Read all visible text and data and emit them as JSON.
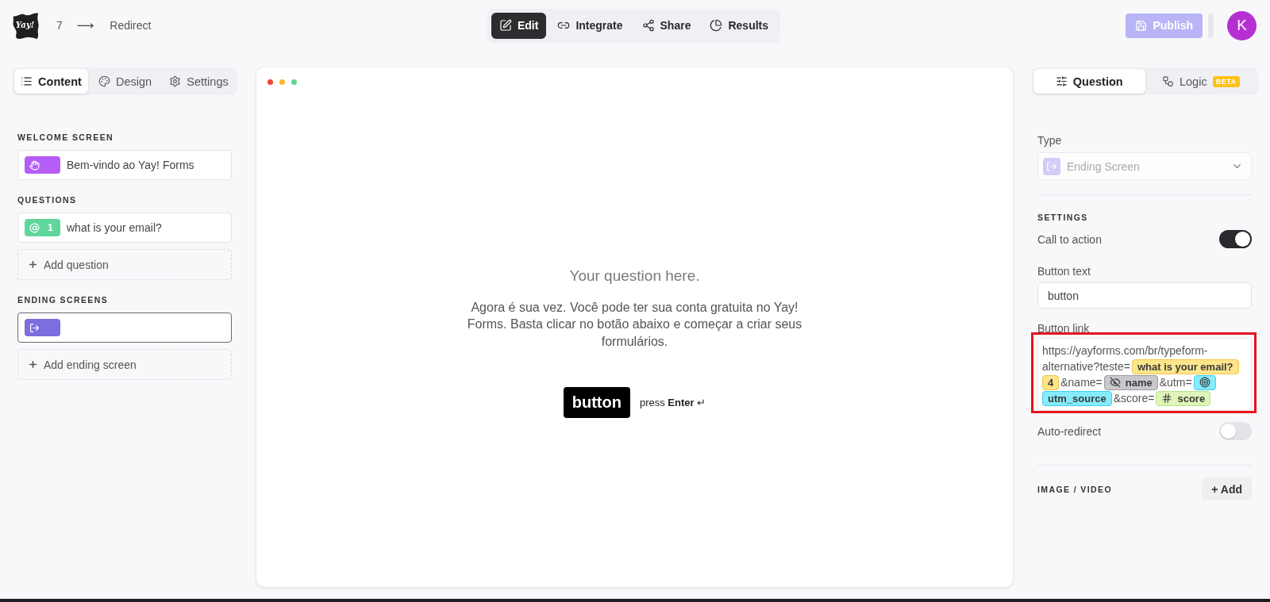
{
  "header": {
    "logo": "Yay!",
    "breadcrumb": {
      "count": "7",
      "arrow": "⟶",
      "title": "Redirect"
    },
    "nav": [
      {
        "label": "Edit",
        "selected": true
      },
      {
        "label": "Integrate",
        "selected": false
      },
      {
        "label": "Share",
        "selected": false
      },
      {
        "label": "Results",
        "selected": false
      }
    ],
    "publish": {
      "label": "Publish",
      "disabled": true
    },
    "avatar": "K"
  },
  "left_panel": {
    "tabs": [
      {
        "label": "Content",
        "selected": true
      },
      {
        "label": "Design",
        "selected": false
      },
      {
        "label": "Settings",
        "selected": false
      }
    ],
    "sections": [
      {
        "heading": "WELCOME SCREEN",
        "items": [
          {
            "kind": "welcome",
            "title": "Bem-vindo ao Yay! Forms",
            "selected": false
          }
        ]
      },
      {
        "heading": "QUESTIONS",
        "items": [
          {
            "kind": "email",
            "number": "1",
            "title": "what is your email?",
            "selected": false
          }
        ],
        "add_label": "Add question"
      },
      {
        "heading": "ENDING SCREENS",
        "items": [
          {
            "kind": "ending",
            "selected": true
          }
        ],
        "add_label": "Add ending screen"
      }
    ]
  },
  "preview": {
    "question": "Your question here.",
    "description": "Agora é sua vez. Você pode ter sua conta gratuita no Yay! Forms. Basta clicar no botão abaixo e começar a criar seus formulários.",
    "button": "button",
    "hint": "press **Enter** ↵"
  },
  "right_panel": {
    "tabs": [
      {
        "label": "Question",
        "selected": true
      },
      {
        "label": "Logic",
        "badge": "BETA",
        "selected": false
      }
    ],
    "type_field": {
      "label": "Type",
      "value": "Ending Screen",
      "disabled": true
    },
    "settings_heading": "SETTINGS",
    "call_to_action": {
      "label": "Call to action",
      "on": true
    },
    "button_text": {
      "label": "Button text",
      "value": "button"
    },
    "button_link": {
      "label": "Button link",
      "highlighted": true,
      "lines": [
        [
          {
            "kind": "text",
            "text": "https://yayforms.com/br/typeform-"
          }
        ],
        [
          {
            "kind": "text",
            "text": "alternative?teste="
          },
          {
            "kind": "question",
            "text": "what is your email?",
            "icon": false
          }
        ],
        [
          {
            "kind": "question",
            "text": "4",
            "icon": false
          },
          {
            "kind": "text",
            "text": "&name="
          },
          {
            "kind": "hidden",
            "text": "name",
            "icon": true
          },
          {
            "kind": "text",
            "text": "&utm="
          },
          {
            "kind": "utm",
            "icon": true
          }
        ],
        [
          {
            "kind": "utm",
            "text": "utm_source",
            "icon": false
          },
          {
            "kind": "text",
            "text": "&score="
          },
          {
            "kind": "score",
            "text": "score",
            "icon": true
          }
        ]
      ]
    },
    "auto_redirect": {
      "label": "Auto-redirect",
      "on": false
    },
    "media": {
      "heading": "IMAGE / VIDEO",
      "add_label": "+ Add"
    }
  }
}
